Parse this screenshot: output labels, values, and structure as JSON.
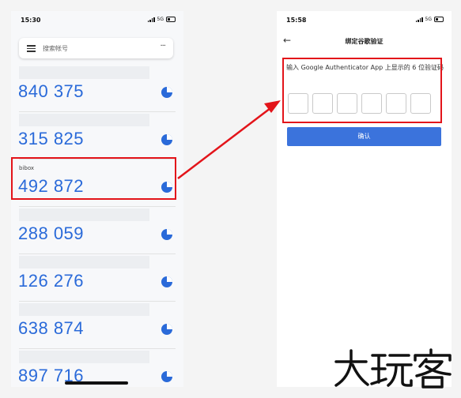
{
  "left_screen": {
    "status_time": "15:30",
    "status_network": "5G",
    "search_placeholder": "搜索帐号",
    "accounts": [
      {
        "issuer": "",
        "code": "840 375"
      },
      {
        "issuer": "",
        "code": "315 825"
      },
      {
        "issuer": "bibox",
        "code": "492 872"
      },
      {
        "issuer": "",
        "code": "288 059"
      },
      {
        "issuer": "",
        "code": "126 276"
      },
      {
        "issuer": "",
        "code": "638 874"
      },
      {
        "issuer": "",
        "code": "897 716"
      }
    ],
    "timer_color": "#2a6ad9"
  },
  "right_screen": {
    "status_time": "15:58",
    "status_network": "5G",
    "title": "绑定谷歌验证",
    "prompt": "输入 Google Authenticator App 上显示的 6 位验证码",
    "digit_count": 6,
    "confirm_label": "确认",
    "button_color": "#3b73dc"
  },
  "annotation": {
    "highlight_color": "#e3141a"
  },
  "watermark": {
    "text": "大玩客"
  }
}
